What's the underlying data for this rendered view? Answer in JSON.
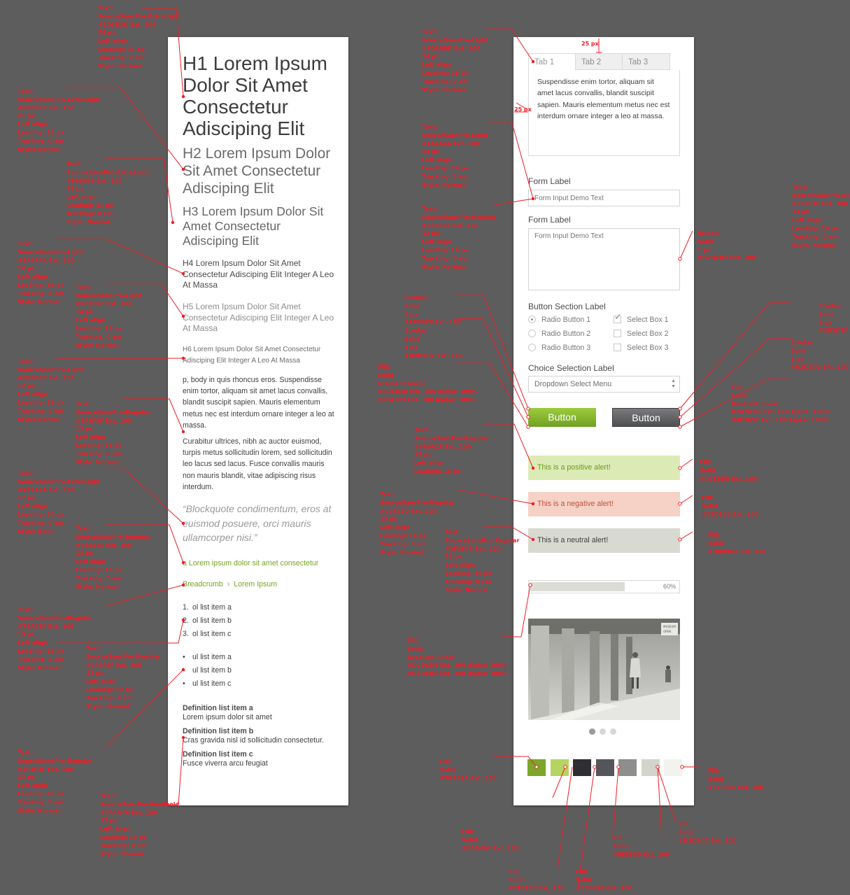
{
  "typography": {
    "h1": "H1 Lorem Ipsum Dolor Sit Amet Consectetur Adisciping Elit",
    "h2": "H2 Lorem Ipsum Dolor Sit Amet Consectetur Adisciping Elit",
    "h3": "H3 Lorem Ipsum Dolor Sit Amet Consectetur Adisciping Elit",
    "h4": "H4 Lorem Ipsum Dolor Sit Amet Consectetur Adisciping Elit Integer A Leo At Massa",
    "h5": "H5 Lorem Ipsum Dolor Sit Amet Consectetur Adisciping Elit Integer A Leo At Massa",
    "h6": "H6 Lorem Ipsum Dolor Sit Amet Consectetur Adisciping Elit Integer A Leo At Massa",
    "p1": "p, body in quis rhoncus eros. Suspendisse enim tortor, aliquam sit amet lacus convallis, blandit suscipit sapien. Mauris elementum metus nec est interdum ornare integer a leo at massa.",
    "p2": "Curabitur ultrices, nibh ac auctor euismod, turpis metus sollicitudin lorem, sed sollicitudin leo lacus sed lacus. Fusce convallis mauris non mauris blandit, vitae adipiscing risus interdum.",
    "blockquote": "“Blockquote condimentum, eros at euismod posuere, orci mauris ullamcorper nisi.”",
    "link": "a Lorem ipsum dolor sit amet consectetur",
    "breadcrumb": [
      "Breadcrumb",
      "Lorem Ipsum"
    ],
    "breadcrumb_sep": "›",
    "ol": [
      {
        "n": "1.",
        "text": "ol list item a"
      },
      {
        "n": "2.",
        "text": "ol list item b"
      },
      {
        "n": "3.",
        "text": "ol list item c"
      }
    ],
    "ul": [
      {
        "n": "•",
        "text": "ul list item a"
      },
      {
        "n": "•",
        "text": "ul list item b"
      },
      {
        "n": "•",
        "text": "ul list item c"
      }
    ],
    "dl": [
      {
        "dt": "Definition list item a",
        "dd": "Lorem ipsum dolor sit amet"
      },
      {
        "dt": "Definition list item b",
        "dd": "Cras gravida nisl id sollicitudin consectetur."
      },
      {
        "dt": "Definition list item c",
        "dd": "Fusce viverra arcu feugiat"
      }
    ]
  },
  "components": {
    "tabs": [
      "Tab 1",
      "Tab 2",
      "Tab 3"
    ],
    "tab_content": "Suspendisse enim tortor, aliquam sit amet lacus convallis, blandit suscipit sapien. Mauris elementum metus nec est interdum ornare integer a leo at massa.",
    "form_label_1": "Form Label",
    "form_input_placeholder": "Form Input Demo Text",
    "form_label_2": "Form Label",
    "form_textarea_placeholder": "Form Input Demo Text",
    "button_section_label": "Button Section Label",
    "radios": [
      {
        "label": "Radio Button 1",
        "checked": true
      },
      {
        "label": "Radio Button 2",
        "checked": false
      },
      {
        "label": "Radio Button 3",
        "checked": false
      }
    ],
    "checkboxes": [
      {
        "label": "Select Box 1",
        "checked": true
      },
      {
        "label": "Select Box 2",
        "checked": false
      },
      {
        "label": "Select Box 3",
        "checked": false
      }
    ],
    "choice_label": "Choice Selection Label",
    "dropdown": "Dropdown Select Menu",
    "button_primary": "Button",
    "button_secondary": "Button",
    "alert_positive": "This is a positive alert!",
    "alert_negative": "This is a negative alert!",
    "alert_neutral": "This is a neutral alert!",
    "progress_value": 0.6,
    "progress_label": "60%",
    "carousel_dots": [
      true,
      false,
      false
    ],
    "swatches": [
      "#7ba62a",
      "#b5d462",
      "#2f2e30",
      "#55565a",
      "#8e8f8d",
      "#d3d4cc",
      "#f2f2ee"
    ],
    "photo_signs": [
      "MUSEUM",
      "OPEN"
    ]
  },
  "annotations": {
    "spacing_top": "25 px",
    "spacing_left": "25 px",
    "notes": {
      "h1": "Text:\nSourceSansPro-ExtraLight\n#3D3D3D Ext. 100\n28 px\nLeft align\nLeading: 31 px\nTracking: 0 em\nStyle: Normal",
      "h2": "Text:\nSourceSansPro-ExtraLight\n#6B6B6B Ext. 100\n21 px\nLeft align\nLeading: 25 px\nTracking: 0 em\nStyle: Normal",
      "h3": "Text:\nSourceSansPro-ExtraLight\n#666666 Ext. 100\n18 px\nLeft align\nLeading: 21 px\nTracking: 0 em\nStyle: Normal",
      "h4": "Text:\nSourceSansPro-Light\n#4A4A4A Ext. 100\n14 px\nLeft align\nLeading: 16 px\nTracking: 0 em\nStyle: Normal",
      "h5": "Text:\nSourceSansPro-Light\n#8C8C8C Ext. 100\n14 px\nLeft align\nLeading: 16 px\nTracking: 0 em\nStyle: Normal",
      "h6": "Text:\nSourceSansPro-Light\n#6B6B6B Ext. 100\n12 px\nLeft align\nLeading: 16 px\nTracking: 0 em\nStyle: Normal",
      "p": "Text:\nSourceSansPro-Regular\n#3F3F3F Ext. 100\n13 px\nLeft align\nLeading: 16 px\nTracking: 0 em\nStyle: Normal",
      "bq": "Text:\nSourceSansPro-ExtraLight\n#9A9A9A Ext. 100\n17 px\nLeft align\nLeading: 20 px\nTracking: 0 em\nStyle: Italic",
      "link": "Text:\nSourceSansPro-Regular\n#76A520 Ext. 100\n13 px\nLeft align\nLeading: 16 px\nTracking: 0 em\nStyle: Normal",
      "bc": "Text:\nSourceSansPro-Regular\n#76A520 Ext. 100\n13 px\nLeft align\nLeading: 16 px\nTracking: 0 em\nStyle: Normal",
      "ol": "Text:\nSourceSansPro-Regular\n#3F3F3F Ext. 100\n13 px\nLeft align\nLeading: 19 px\nTracking: 0 em\nStyle: Normal",
      "ul": "Text:\nSourceSansPro-Regular\n#3F3F3F Ext. 100\n13 px\nLeft align\nLeading: 19 px\nTracking: 0 em\nStyle: Normal",
      "dd": "Text:\nSourceSansPro-Regular\n#3F3F3F Ext. 100\n13 px\nLeft align\nLeading: 13 px\nTracking: 0 em\nStyle: Normal",
      "dt": "Text:\nSourceSansPro-Semibold\n#4A4A4A Ext. 100\n13 px\nLeft align\nLeading: 13 px\nTracking: 0 em\nStyle: Normal",
      "tab": "Text:\nSourceSansPro-Light\n#8D8D8D Ext. 100\n14 px\nLeft align\nLeading: 16 px\nTracking: 0 em\nStyle: Normal",
      "label": "Text:\nSourceSansPro-Light\n#4A4A4A Ext. 100\n14 px\nLeft align\nLeading: 16 px\nTracking: 0 em\nStyle: Normal",
      "input": "Text:\nSourceSansPro-Regular\n#C0C0C0 Ext. 100\n12 px\nLeft align\nLeading: 16 px\nTracking: 0 em\nStyle: Normal",
      "tabbody": "Text:\nSourceSansPro-Regular\n#3F3F3F Ext. 100\n13 px\nLeft align\nLeading: 16 px\nTracking: 0 em\nStyle: Normal",
      "stroke_input": "Stroke:\nSolid\n1 px\n#D2D2D2 Ext. 100",
      "stroke_opts": "Stroke:\nSolid\n1 px\n#C8C8C8 Ext. 100\nStroke:\nSolid\n1 px\n#D2D2D2 Ext. 100",
      "fill_green": "Fill:\nSolid\nGradient linear\n#9DCB3D Ext. 100 Alpha: 100%\n#6FA123 Ext. 100 Alpha: 100%",
      "stroke_grey": "Stroke:\nSolid\n1 px\n#3D3D3F Ext. 100",
      "stroke_grey2": "Stroke:\nSolid\n1 px\n#D2D2D2 Ext. 100",
      "fill_grey": "Fill:\nSolid\nGradient linear\n#7A7B7D Ext. 100 Alpha: 100%\n#4F5052 Ext. 100 Alpha: 100%",
      "alert_text_pos": "Text:\nSourceSansPro-Regular\n#6A9A1F Ext. 100\n13 px\nLeft align\nLeading: 16 px",
      "alert_text_neg": "Text:\nSourceSansPro-Regular\n#C0533D Ext. 100\n13 px\nLeft align\nLeading: 16 px\nTracking: 0 em\nStyle: Normal",
      "alert_text_neu": "Text:\nSourceSansPro-Regular\n#3F3F3F Ext. 100\n13 px\nLeft align\nLeading: 16 px\nTracking: 0 em\nStyle: Normal",
      "fill_pos": "Fill:\nSolid\n#DCEBB6 Ext. 100",
      "fill_neg": "Fill:\nSolid\n#F5D1C6 Ext. 100",
      "fill_neu": "Fill:\nSolid\n#D8D9D0 Ext. 100",
      "fill_progress": "Fill:\nSolid\nGradient linear\n#DCDCD6 Ext. 100 Alpha: 100%\n#DCDCD6 Ext. 100 Alpha: 100%",
      "sw1": "Fill:\nSolid\n#7BA62A Ext. 100",
      "sw2": "Fill:\nSolid\n#B5D462 Ext. 100",
      "sw3": "Fill:\nSolid\n#2F2E30 Ext. 100",
      "sw4": "Fill:\nSolid\n#55565A Ext. 100",
      "sw5": "Fill:\nSolid\n#8E8F8D Ext. 100",
      "sw6": "Fill:\nSolid\n#D3D4CC Ext. 100",
      "sw7": "Fill:\nSolid\n#F2F2EE Ext. 100"
    }
  }
}
